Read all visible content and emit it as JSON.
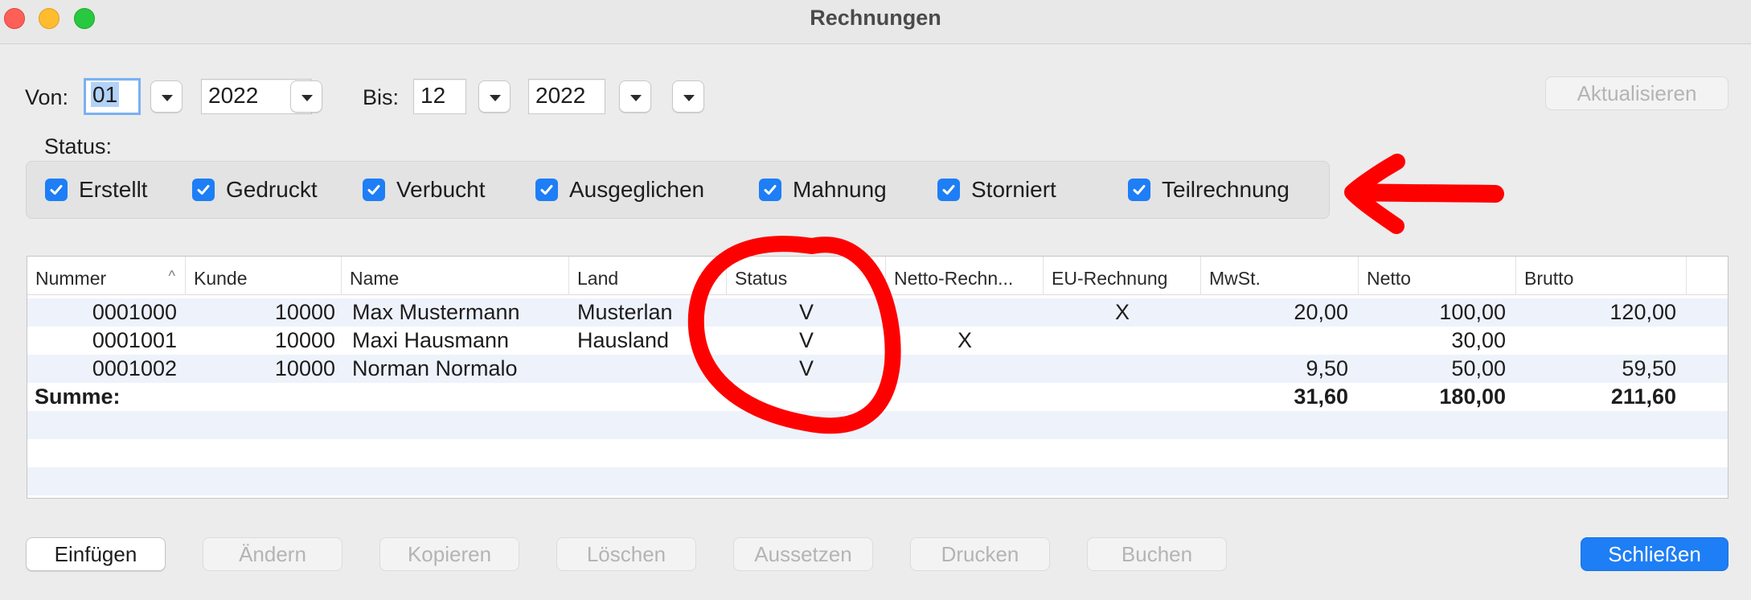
{
  "window": {
    "title": "Rechnungen"
  },
  "filter": {
    "von_label": "Von:",
    "von_month": "01",
    "von_year": "2022",
    "bis_label": "Bis:",
    "bis_month": "12",
    "bis_year": "2022",
    "refresh_label": "Aktualisieren"
  },
  "status": {
    "label": "Status:",
    "options": [
      {
        "label": "Erstellt",
        "checked": true
      },
      {
        "label": "Gedruckt",
        "checked": true
      },
      {
        "label": "Verbucht",
        "checked": true
      },
      {
        "label": "Ausgeglichen",
        "checked": true
      },
      {
        "label": "Mahnung",
        "checked": true
      },
      {
        "label": "Storniert",
        "checked": true
      },
      {
        "label": "Teilrechnung",
        "checked": true
      }
    ]
  },
  "table": {
    "columns": [
      "Nummer",
      "Kunde",
      "Name",
      "Land",
      "Status",
      "Netto-Rechn...",
      "EU-Rechnung",
      "MwSt.",
      "Netto",
      "Brutto"
    ],
    "sort_indicator": "^",
    "rows": [
      {
        "nummer": "0001000",
        "kunde": "10000",
        "name": "Max Mustermann",
        "land": "Musterlan",
        "status": "V",
        "netto_rechnung": "",
        "eu_rechnung": "X",
        "mwst": "20,00",
        "netto": "100,00",
        "brutto": "120,00"
      },
      {
        "nummer": "0001001",
        "kunde": "10000",
        "name": "Maxi Hausmann",
        "land": "Hausland",
        "status": "V",
        "netto_rechnung": "X",
        "eu_rechnung": "",
        "mwst": "",
        "netto": "30,00",
        "brutto": ""
      },
      {
        "nummer": "0001002",
        "kunde": "10000",
        "name": "Norman Normalo",
        "land": "",
        "status": "V",
        "netto_rechnung": "",
        "eu_rechnung": "",
        "mwst": "9,50",
        "netto": "50,00",
        "brutto": "59,50"
      }
    ],
    "summary": {
      "label": "Summe:",
      "mwst": "31,60",
      "netto": "180,00",
      "brutto": "211,60"
    }
  },
  "buttons": {
    "einfuegen": "Einfügen",
    "aendern": "Ändern",
    "kopieren": "Kopieren",
    "loeschen": "Löschen",
    "aussetzen": "Aussetzen",
    "drucken": "Drucken",
    "buchen": "Buchen",
    "schliessen": "Schließen"
  },
  "colors": {
    "accent": "#1e7ef5",
    "annotation": "#ff0000"
  }
}
